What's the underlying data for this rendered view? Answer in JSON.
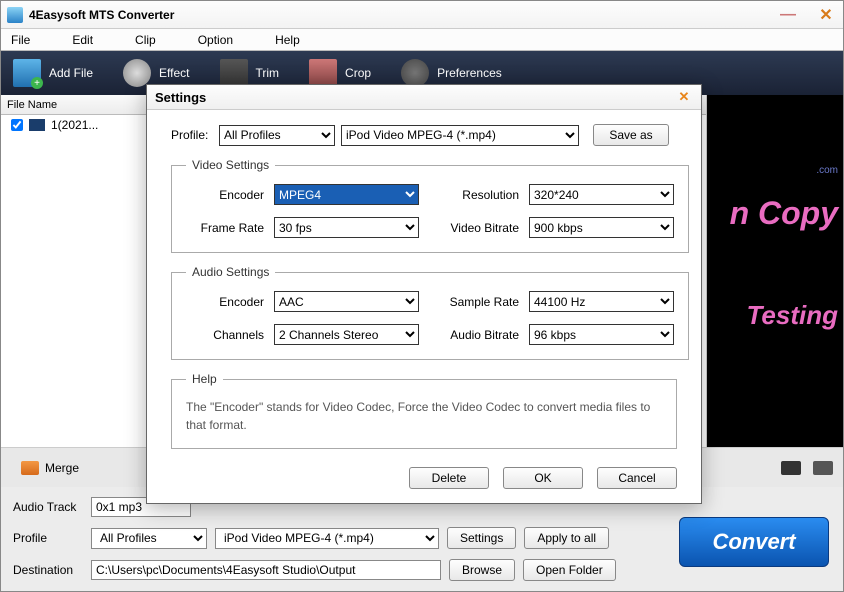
{
  "window": {
    "title": "4Easysoft MTS Converter"
  },
  "menubar": [
    "File",
    "Edit",
    "Clip",
    "Option",
    "Help"
  ],
  "toolbar": {
    "addFile": "Add File",
    "effect": "Effect",
    "trim": "Trim",
    "crop": "Crop",
    "preferences": "Preferences"
  },
  "filelist": {
    "header": "File Name",
    "items": [
      {
        "checked": true,
        "name": "1(2021..."
      }
    ]
  },
  "preview": {
    "line1": "n Copy",
    "line2": ".com",
    "line3": "Testing"
  },
  "ops": {
    "merge": "Merge"
  },
  "bottom": {
    "audioTrack": {
      "label": "Audio Track",
      "value": "0x1 mp3"
    },
    "profile": {
      "label": "Profile",
      "sel1": "All Profiles",
      "sel2": "iPod Video MPEG-4 (*.mp4)",
      "settings": "Settings",
      "applyAll": "Apply to all"
    },
    "destination": {
      "label": "Destination",
      "value": "C:\\Users\\pc\\Documents\\4Easysoft Studio\\Output",
      "browse": "Browse",
      "openFolder": "Open Folder"
    },
    "convert": "Convert"
  },
  "dialog": {
    "title": "Settings",
    "profile": {
      "label": "Profile:",
      "sel1": "All Profiles",
      "sel2": "iPod Video MPEG-4 (*.mp4)",
      "saveAs": "Save as"
    },
    "video": {
      "legend": "Video Settings",
      "encoder": {
        "label": "Encoder",
        "value": "MPEG4"
      },
      "resolution": {
        "label": "Resolution",
        "value": "320*240"
      },
      "frameRate": {
        "label": "Frame Rate",
        "value": "30 fps"
      },
      "videoBitrate": {
        "label": "Video Bitrate",
        "value": "900 kbps"
      }
    },
    "audio": {
      "legend": "Audio Settings",
      "encoder": {
        "label": "Encoder",
        "value": "AAC"
      },
      "sampleRate": {
        "label": "Sample Rate",
        "value": "44100 Hz"
      },
      "channels": {
        "label": "Channels",
        "value": "2 Channels Stereo"
      },
      "audioBitrate": {
        "label": "Audio Bitrate",
        "value": "96 kbps"
      }
    },
    "help": {
      "legend": "Help",
      "text": "The \"Encoder\" stands for Video Codec, Force the Video Codec to convert media files to that format."
    },
    "buttons": {
      "delete": "Delete",
      "ok": "OK",
      "cancel": "Cancel"
    }
  }
}
